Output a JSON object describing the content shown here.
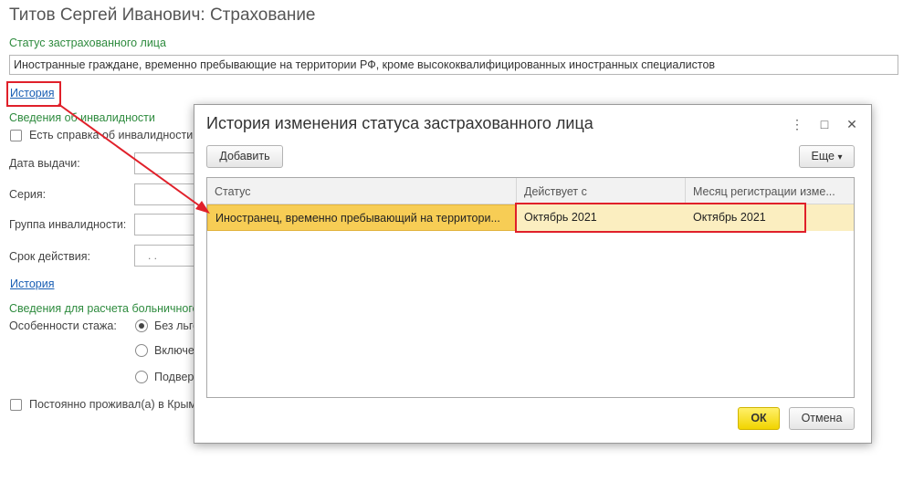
{
  "page": {
    "title": "Титов Сергей Иванович: Страхование"
  },
  "insured_status": {
    "label": "Статус застрахованного лица",
    "value": "Иностранные граждане, временно пребывающие на территории РФ, кроме высококвалифицированных иностранных специалистов",
    "history_link": "История"
  },
  "disability": {
    "section_label": "Сведения об инвалидности",
    "has_certificate_label": "Есть справка об инвалидности",
    "issue_date_label": "Дата выдачи:",
    "series_label": "Серия:",
    "group_label": "Группа инвалидности:",
    "validity_label": "Срок действия:",
    "validity_value": ". .",
    "history_link": "История"
  },
  "sick_leave": {
    "section_label": "Сведения для расчета больничного",
    "experience_label": "Особенности стажа:",
    "options": [
      "Без льгот",
      "Включе",
      "Подвер"
    ]
  },
  "crimea": {
    "label": "Постоянно проживал(а) в Крыму"
  },
  "dialog": {
    "title": "История изменения статуса застрахованного лица",
    "add_button": "Добавить",
    "more_button": "Еще",
    "more_arrow": "▾",
    "columns": [
      "Статус",
      "Действует с",
      "Месяц регистрации изме..."
    ],
    "rows": [
      {
        "status": "Иностранец, временно пребывающий на территори...",
        "effective_from": "Октябрь 2021",
        "registration_month": "Октябрь 2021"
      }
    ],
    "ok_button": "ОК",
    "cancel_button": "Отмена",
    "menu_glyph": "⋮",
    "maximize_glyph": "□",
    "close_glyph": "✕"
  },
  "colors": {
    "highlight_red": "#e0202a",
    "section_green": "#2e8b3e",
    "selected_row": "#f7cd55",
    "link_blue": "#1a5fb4"
  }
}
